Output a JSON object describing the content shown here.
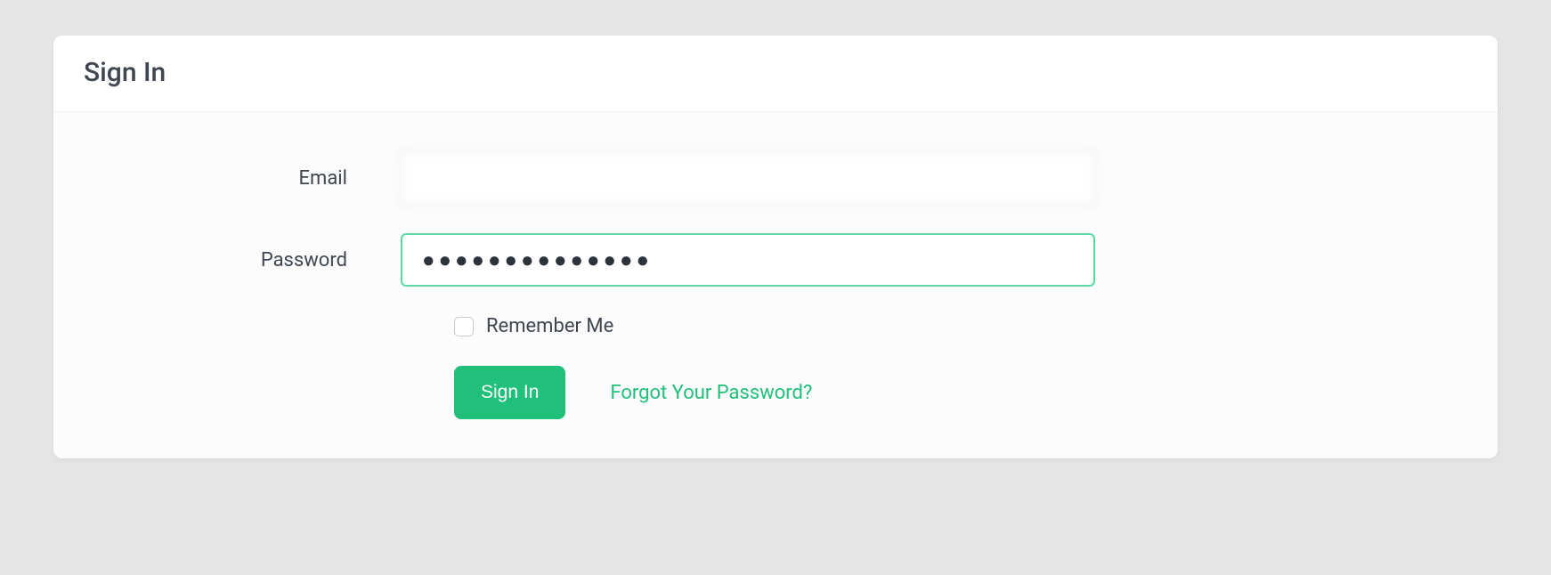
{
  "card": {
    "title": "Sign In"
  },
  "form": {
    "email": {
      "label": "Email",
      "value": ""
    },
    "password": {
      "label": "Password",
      "masked_value": "●●●●●●●●●●●●●●"
    },
    "remember": {
      "label": "Remember Me",
      "checked": false
    },
    "submit": {
      "label": "Sign In"
    },
    "forgot": {
      "label": "Forgot Your Password?"
    }
  },
  "colors": {
    "accent": "#20bf7a",
    "focus_border": "#5bd8a6"
  }
}
